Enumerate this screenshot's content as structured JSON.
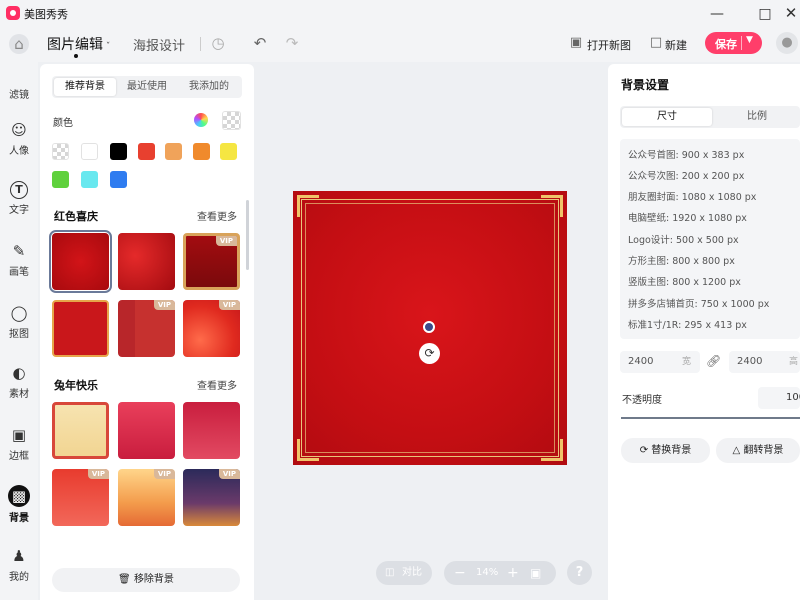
{
  "app": {
    "title": "美图秀秀"
  },
  "window": {
    "minimize_icon": "minimize-icon",
    "maximize_icon": "maximize-icon",
    "close_icon": "close-icon"
  },
  "toolbar": {
    "tab_edit": "图片编辑",
    "tab_poster": "海报设计",
    "open_new": "打开新图",
    "new": "新建",
    "save": "保存"
  },
  "rail": [
    {
      "label": "滤镜",
      "icon": "filter-icon"
    },
    {
      "label": "人像",
      "icon": "portrait-icon"
    },
    {
      "label": "文字",
      "icon": "text-icon"
    },
    {
      "label": "画笔",
      "icon": "brush-icon"
    },
    {
      "label": "抠图",
      "icon": "cutout-icon"
    },
    {
      "label": "素材",
      "icon": "sticker-icon"
    },
    {
      "label": "边框",
      "icon": "border-icon"
    },
    {
      "label": "背景",
      "icon": "background-icon",
      "active": true
    },
    {
      "label": "我的",
      "icon": "user-icon"
    }
  ],
  "left_panel": {
    "tabs": [
      "推荐背景",
      "最近使用",
      "我添加的"
    ],
    "active_tab": "推荐背景",
    "color_label": "颜色",
    "colors": [
      "transparent",
      "#ffffff",
      "#000000",
      "#e8402f",
      "#f0a35a",
      "#f08a2c",
      "#f5e642",
      "#5fd13c",
      "#68e8ef",
      "#2f7cf0"
    ],
    "sections": [
      {
        "title": "红色喜庆",
        "more": "查看更多"
      },
      {
        "title": "兔年快乐",
        "more": "查看更多"
      }
    ],
    "vip_label": "VIP",
    "remove_bg": "移除背景"
  },
  "bottom_bar": {
    "compare": "对比",
    "zoom": "14%"
  },
  "right_panel": {
    "title": "背景设置",
    "tabs": [
      "尺寸",
      "比例"
    ],
    "active_tab": "尺寸",
    "sizes": [
      "公众号首图: 900 x 383 px",
      "公众号次图: 200 x 200 px",
      "朋友圈封面: 1080 x 1080 px",
      "电脑壁纸: 1920 x 1080 px",
      "Logo设计: 500 x 500 px",
      "方形主图: 800 x 800 px",
      "竖版主图: 800 x 1200 px",
      "拼多多店铺首页: 750 x 1000 px",
      "标准1寸/1R: 295 x 413 px"
    ],
    "width_value": "2400",
    "width_unit": "宽",
    "height_value": "2400",
    "height_unit": "高",
    "opacity_label": "不透明度",
    "opacity_value": "100",
    "replace_bg": "替换背景",
    "flip_bg": "翻转背景"
  },
  "colors": {
    "accent": "#ff3e6a",
    "canvas_red": "#c40e13",
    "gold": "#e8c47a"
  }
}
